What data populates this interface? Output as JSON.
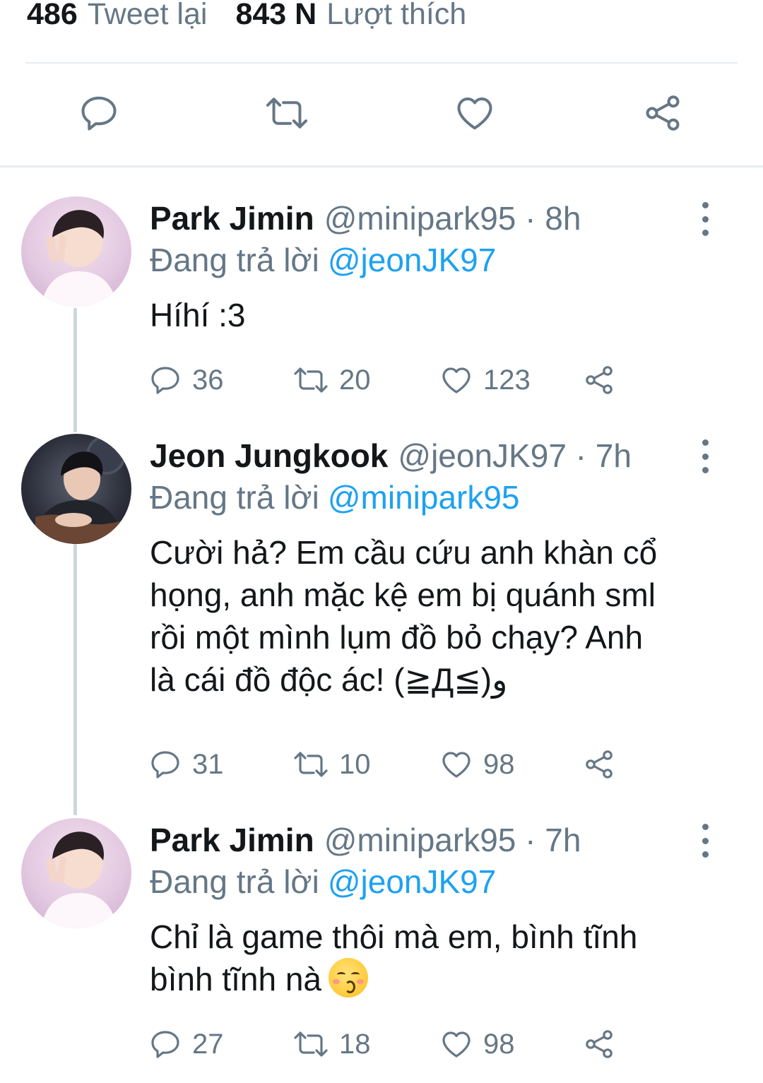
{
  "stats": {
    "retweets_count": "486",
    "retweets_label": "Tweet lại",
    "likes_count": "843 N",
    "likes_label": "Lượt thích"
  },
  "main_actions": [
    "reply-icon",
    "retweet-icon",
    "like-icon",
    "share-icon"
  ],
  "colors": {
    "text": "#14171a",
    "secondary": "#657786",
    "link": "#1da1f2",
    "divider": "#e6ecf0",
    "thread_line": "#ccd6dd"
  },
  "tweets": [
    {
      "name": "Park Jimin",
      "handle": "@minipark95 · 8h",
      "replying_label": "Đang trả lời",
      "replying_to": "@jeonJK97",
      "body": [
        "Híhí :3"
      ],
      "replies": "36",
      "retweets": "20",
      "likes": "123"
    },
    {
      "name": "Jeon Jungkook",
      "handle": "@jeonJK97 · 7h",
      "replying_label": "Đang trả lời",
      "replying_to": "@minipark95",
      "body": [
        "Cười hả? Em cầu cứu anh khàn cổ",
        "họng, anh mặc kệ em bị quánh sml",
        "rồi một mình lụm đồ bỏ chạy? Anh",
        "là cái đồ độc ác! (≧Д≦)و"
      ],
      "replies": "31",
      "retweets": "10",
      "likes": "98"
    },
    {
      "name": "Park Jimin",
      "handle": "@minipark95 · 7h",
      "replying_label": "Đang trả lời",
      "replying_to": "@jeonJK97",
      "body": [
        "Chỉ là game thôi mà em, bình tĩnh",
        "bình tĩnh nà"
      ],
      "replies": "27",
      "retweets": "18",
      "likes": "98"
    }
  ]
}
